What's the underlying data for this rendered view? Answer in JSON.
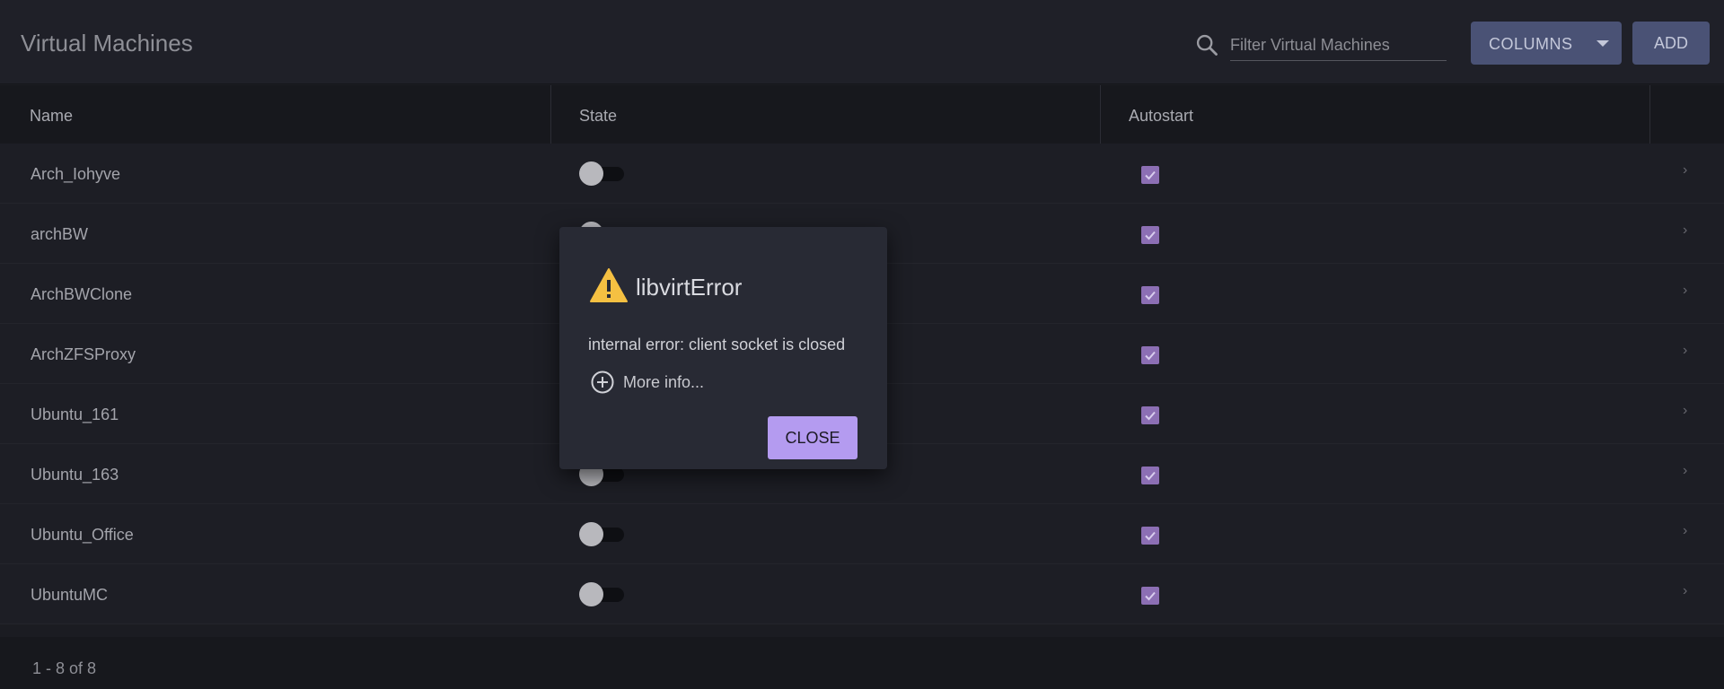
{
  "header": {
    "title": "Virtual Machines",
    "search_placeholder": "Filter Virtual Machines",
    "columns_label": "COLUMNS",
    "add_label": "ADD"
  },
  "table": {
    "columns": [
      "Name",
      "State",
      "Autostart"
    ],
    "rows": [
      {
        "name": "Arch_Iohyve",
        "state_on": false,
        "autostart": true
      },
      {
        "name": "archBW",
        "state_on": false,
        "autostart": true
      },
      {
        "name": "ArchBWClone",
        "state_on": false,
        "autostart": true
      },
      {
        "name": "ArchZFSProxy",
        "state_on": false,
        "autostart": true
      },
      {
        "name": "Ubuntu_161",
        "state_on": false,
        "autostart": true
      },
      {
        "name": "Ubuntu_163",
        "state_on": false,
        "autostart": true
      },
      {
        "name": "Ubuntu_Office",
        "state_on": false,
        "autostart": true
      },
      {
        "name": "UbuntuMC",
        "state_on": false,
        "autostart": true
      }
    ]
  },
  "footer": {
    "pagination": "1 - 8 of 8"
  },
  "dialog": {
    "icon": "warning-icon",
    "title": "libvirtError",
    "message": "internal error: client socket is closed",
    "more_info": "More info...",
    "close_label": "CLOSE"
  },
  "colors": {
    "background": "#1b1c22",
    "primary_button": "#4a5275",
    "accent": "#b49bf0",
    "checkbox": "#8c6fb4",
    "warning": "#f5c042"
  }
}
